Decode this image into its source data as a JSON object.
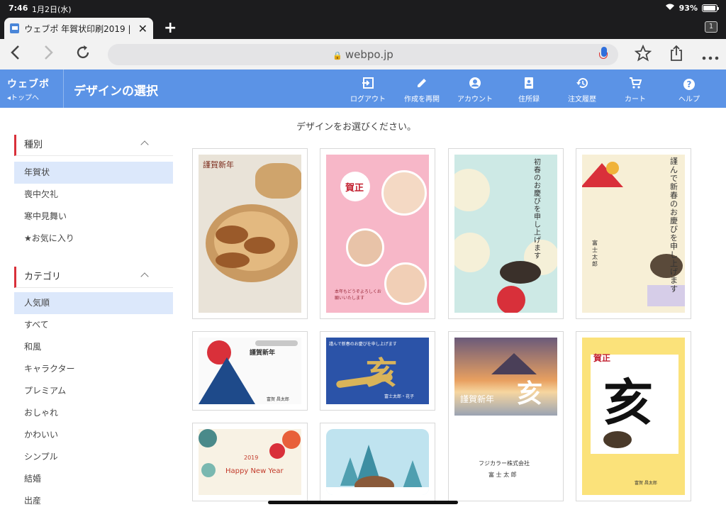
{
  "status": {
    "time": "7:46",
    "date": "1月2日(水)",
    "battery": "93%",
    "battery_level": 0.93
  },
  "browser": {
    "tab_title": "ウェブポ 年賀状印刷2019 |",
    "tab_count": "1",
    "url": "webpo.jp"
  },
  "header": {
    "logo": "ウェブポ",
    "back_label": "トップへ",
    "title": "デザインの選択",
    "nav": [
      {
        "label": "ログアウト",
        "icon": "logout-icon"
      },
      {
        "label": "作成を再開",
        "icon": "pencil-icon"
      },
      {
        "label": "アカウント",
        "icon": "account-icon"
      },
      {
        "label": "住所録",
        "icon": "address-book-icon"
      },
      {
        "label": "注文履歴",
        "icon": "history-icon"
      },
      {
        "label": "カート",
        "icon": "cart-icon"
      },
      {
        "label": "ヘルプ",
        "icon": "help-icon"
      }
    ]
  },
  "sidebar": {
    "type_heading": "種別",
    "types": [
      "年賀状",
      "喪中欠礼",
      "寒中見舞い",
      "★お気に入り"
    ],
    "category_heading": "カテゴリ",
    "categories": [
      "人気順",
      "すべて",
      "和風",
      "キャラクター",
      "プレミアム",
      "おしゃれ",
      "かわいい",
      "シンプル",
      "結婚",
      "出産"
    ]
  },
  "main": {
    "instruction": "デザインをお選びください。",
    "cards": [
      {
        "texts": [
          "謹賀新年"
        ]
      },
      {
        "texts": [
          "賀正",
          "本年もどうぞよろしくお願いいたします"
        ]
      },
      {
        "texts": [
          "初春のお慶びを申し上げます"
        ]
      },
      {
        "texts": [
          "謹んで新春のお慶びを申し上げます",
          "富士太郎"
        ]
      },
      {
        "texts": [
          "謹賀新年",
          "富賀 昌太郎"
        ]
      },
      {
        "texts": [
          "謹んで新春のお慶びを申し上げます",
          "亥",
          "富士太郎・花子"
        ]
      },
      {
        "texts": [
          "謹賀新年",
          "亥",
          "フジカラー株式会社",
          "富 士 太 郎"
        ]
      },
      {
        "texts": [
          "賀正",
          "亥",
          "富賀 昌太郎"
        ]
      },
      {
        "texts": [
          "2019",
          "Happy New Year"
        ]
      },
      {
        "texts": []
      }
    ]
  },
  "colors": {
    "accent": "#5b93e6",
    "active_bg": "#dce8fb",
    "heading_bar": "#d9303a"
  }
}
